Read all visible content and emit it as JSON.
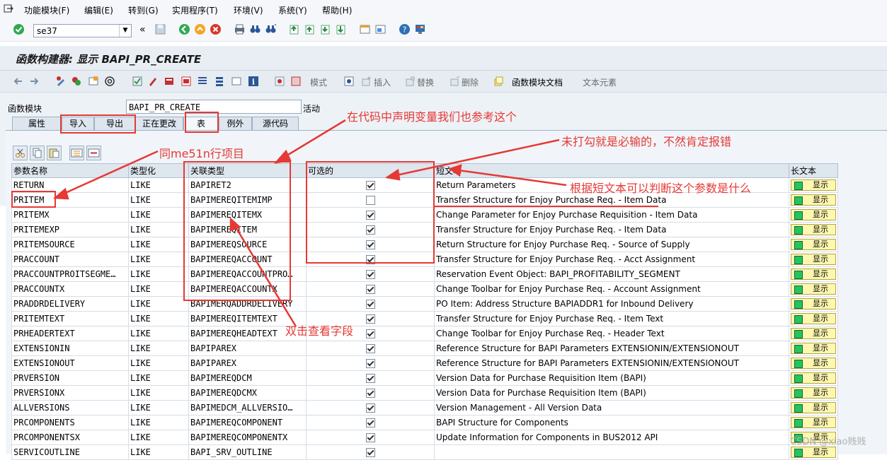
{
  "menubar": {
    "items": [
      "功能模块(F)",
      "编辑(E)",
      "转到(G)",
      "实用程序(T)",
      "环境(V)",
      "系统(Y)",
      "帮助(H)"
    ]
  },
  "toolbar": {
    "command_value": "se37",
    "nav_back": "«"
  },
  "title": "函数构建器: 显示 BAPI_PR_CREATE",
  "app_toolbar": {
    "pattern_label": "模式",
    "insert_label": "插入",
    "replace_label": "替换",
    "delete_label": "删除",
    "fm_doc_label": "函数模块文档",
    "text_elements_label": "文本元素"
  },
  "header": {
    "fm_label": "函数模块",
    "fm_value": "BAPI_PR_CREATE",
    "status": "活动"
  },
  "tabs": [
    "属性",
    "导入",
    "导出",
    "正在更改",
    "表",
    "例外",
    "源代码"
  ],
  "active_tab": "表",
  "table": {
    "columns": [
      "参数名称",
      "类型化",
      "关联类型",
      "可选的",
      "短文本",
      "长文本"
    ],
    "show_label": "显示",
    "rows": [
      {
        "name": "RETURN",
        "typing": "LIKE",
        "type": "BAPIRET2",
        "optional": true,
        "text": "Return Parameters"
      },
      {
        "name": "PRITEM",
        "typing": "LIKE",
        "type": "BAPIMEREQITEMIMP",
        "optional": false,
        "text": "Transfer Structure for Enjoy Purchase Req. - Item Data"
      },
      {
        "name": "PRITEMX",
        "typing": "LIKE",
        "type": "BAPIMEREQITEMX",
        "optional": true,
        "text": "Change Parameter for Enjoy Purchase Requisition - Item Data"
      },
      {
        "name": "PRITEMEXP",
        "typing": "LIKE",
        "type": "BAPIMEREQITEM",
        "optional": true,
        "text": "Transfer Structure for Enjoy Purchase Req. - Item Data"
      },
      {
        "name": "PRITEMSOURCE",
        "typing": "LIKE",
        "type": "BAPIMEREQSOURCE",
        "optional": true,
        "text": "Return Structure for Enjoy Purchase Req. - Source of Supply"
      },
      {
        "name": "PRACCOUNT",
        "typing": "LIKE",
        "type": "BAPIMEREQACCOUNT",
        "optional": true,
        "text": "Transfer Structure for Enjoy Purchase Req. - Acct Assignment"
      },
      {
        "name": "PRACCOUNTPROITSEGME…",
        "typing": "LIKE",
        "type": "BAPIMEREQACCOUNTPRO…",
        "optional": true,
        "text": "Reservation Event Object: BAPI_PROFITABILITY_SEGMENT"
      },
      {
        "name": "PRACCOUNTX",
        "typing": "LIKE",
        "type": "BAPIMEREQACCOUNTX",
        "optional": true,
        "text": "Change Toolbar for Enjoy Purchase Req. - Account Assignment"
      },
      {
        "name": "PRADDRDELIVERY",
        "typing": "LIKE",
        "type": "BAPIMERQADDRDELIVERY",
        "optional": true,
        "text": "PO Item: Address Structure BAPIADDR1 for Inbound Delivery"
      },
      {
        "name": "PRITEMTEXT",
        "typing": "LIKE",
        "type": "BAPIMEREQITEMTEXT",
        "optional": true,
        "text": "Transfer Structure for Enjoy Purchase Req. - Item Text"
      },
      {
        "name": "PRHEADERTEXT",
        "typing": "LIKE",
        "type": "BAPIMEREQHEADTEXT",
        "optional": true,
        "text": "Change Toolbar for Enjoy Purchase Req. - Header Text"
      },
      {
        "name": "EXTENSIONIN",
        "typing": "LIKE",
        "type": "BAPIPAREX",
        "optional": true,
        "text": "Reference Structure for BAPI Parameters EXTENSIONIN/EXTENSIONOUT"
      },
      {
        "name": "EXTENSIONOUT",
        "typing": "LIKE",
        "type": "BAPIPAREX",
        "optional": true,
        "text": "Reference Structure for BAPI Parameters EXTENSIONIN/EXTENSIONOUT"
      },
      {
        "name": "PRVERSION",
        "typing": "LIKE",
        "type": "BAPIMEREQDCM",
        "optional": true,
        "text": "Version Data for Purchase Requisition Item (BAPI)"
      },
      {
        "name": "PRVERSIONX",
        "typing": "LIKE",
        "type": "BAPIMEREQDCMX",
        "optional": true,
        "text": "Version Data for Purchase Requisition Item (BAPI)"
      },
      {
        "name": "ALLVERSIONS",
        "typing": "LIKE",
        "type": "BAPIMEDCM_ALLVERSIO…",
        "optional": true,
        "text": "Version Management - All Version Data"
      },
      {
        "name": "PRCOMPONENTS",
        "typing": "LIKE",
        "type": "BAPIMEREQCOMPONENT",
        "optional": true,
        "text": "BAPI Structure for Components"
      },
      {
        "name": "PRCOMPONENTSX",
        "typing": "LIKE",
        "type": "BAPIMEREQCOMPONENTX",
        "optional": true,
        "text": "Update Information for Components in BUS2012 API"
      },
      {
        "name": "SERVICOUTLINE",
        "typing": "LIKE",
        "type": "BAPI_SRV_OUTLINE",
        "optional": true,
        "text": ""
      }
    ]
  },
  "annotations": {
    "declare_vars": "在代码中声明变量我们也参考这个",
    "me51n": "同me51n行项目",
    "required": "未打勾就是必输的，不然肯定报错",
    "short_text": "根据短文本可以判断这个参数是什么",
    "double_click": "双击查看字段",
    "color": "#e53935"
  },
  "watermark": "CSDN @xiao贱贱"
}
